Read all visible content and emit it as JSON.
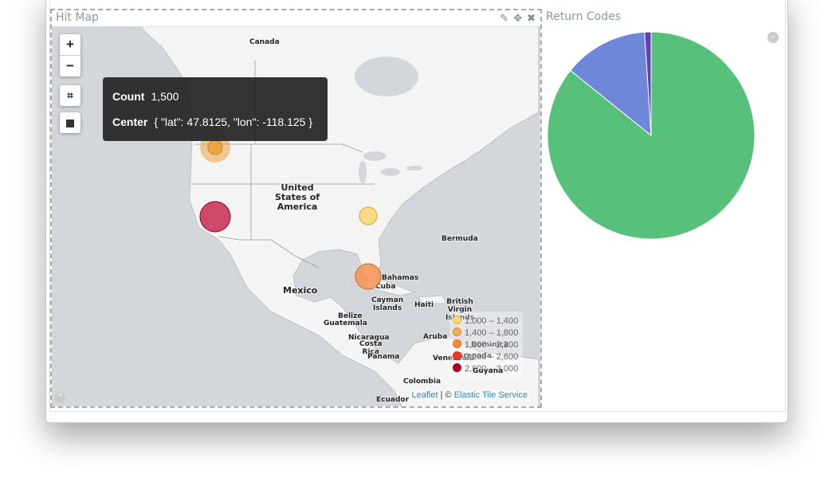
{
  "map_panel": {
    "title": "Hit Map",
    "actions": {
      "edit_icon": "pencil-icon",
      "move_icon": "move-icon",
      "close_icon": "close-icon"
    },
    "controls": {
      "zoom_in": "+",
      "zoom_out": "−",
      "crop_icon": "crop-icon",
      "stop_icon": "square-icon"
    },
    "tooltip": {
      "count_label": "Count",
      "count_value": "1,500",
      "center_label": "Center",
      "center_value": "{ \"lat\": 47.8125, \"lon\": -118.125 }"
    },
    "labels": {
      "canada": "Canada",
      "usa": "United\nStates of\nAmerica",
      "mexico": "Mexico",
      "bermuda": "Bermuda",
      "bahamas": "Bahamas",
      "cuba": "Cuba",
      "cayman": "Cayman\nIslands",
      "haiti": "Haiti",
      "bvi": "British\nVirgin\nIslands",
      "dominica": "Dominica",
      "grenada": "Grenada",
      "belize": "Belize",
      "guatemala": "Guatemala",
      "nicaragua": "Nicaragua",
      "costa_rica": "Costa\nRica",
      "panama": "Panama",
      "aruba": "Aruba",
      "venezuela": "Venezuela",
      "guyana": "Guyana",
      "colombia": "Colombia",
      "ecuador": "Ecuador"
    },
    "points": [
      {
        "count": 1500,
        "color": "#e9a23b"
      },
      {
        "count": 2800,
        "color": "#c9294f"
      },
      {
        "count": 1200,
        "color": "#fdd672"
      },
      {
        "count": 1900,
        "color": "#f4924f"
      }
    ],
    "legend": [
      {
        "label": "1,000 – 1,400",
        "color": "#fdd672"
      },
      {
        "label": "1,400 – 1,800",
        "color": "#f7ad47"
      },
      {
        "label": "1,800 – 2,200",
        "color": "#f68a2e"
      },
      {
        "label": "2,200 – 2,600",
        "color": "#ec3a21"
      },
      {
        "label": "2,600 – 3,000",
        "color": "#b10026"
      }
    ],
    "attribution": {
      "leaflet": "Leaflet",
      "sep": " | © ",
      "tiles": "Elastic Tile Service"
    }
  },
  "pie_panel": {
    "title": "Return Codes",
    "legend_toggle_icon": "chevron-left-circle-icon"
  },
  "chart_data": {
    "type": "pie",
    "title": "Return Codes",
    "slices": [
      {
        "value": 85.8,
        "color": "#57c17b"
      },
      {
        "value": 13.2,
        "color": "#6f87d8"
      },
      {
        "value": 1.0,
        "color": "#663db8"
      }
    ]
  }
}
